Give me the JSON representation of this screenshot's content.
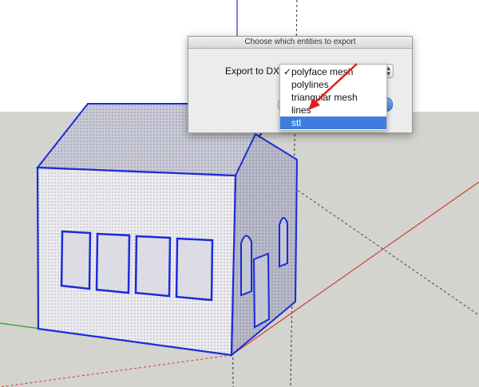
{
  "dialog": {
    "title": "Choose which entities to export",
    "export_label": "Export to DXF"
  },
  "dropdown": {
    "options": [
      {
        "label": "polyface mesh",
        "checked": true
      },
      {
        "label": "polylines",
        "checked": false
      },
      {
        "label": "triangular mesh",
        "checked": false
      },
      {
        "label": "lines",
        "checked": false
      },
      {
        "label": "stl",
        "checked": false
      }
    ],
    "highlighted": "stl",
    "check_mark": "✓"
  },
  "colors": {
    "sky": "#ffffff",
    "ground": "#d3d3cf",
    "selection_edge": "#1a2bd8",
    "face_fill": "#ececf0",
    "roof_fill": "#c9cad6",
    "side_fill": "#b8bac9",
    "axis_red": "#d23b2b",
    "axis_green": "#1aa52b",
    "axis_blue": "#2233cc",
    "menu_highlight": "#3e7de0",
    "annotation_arrow": "#e01b1b"
  }
}
